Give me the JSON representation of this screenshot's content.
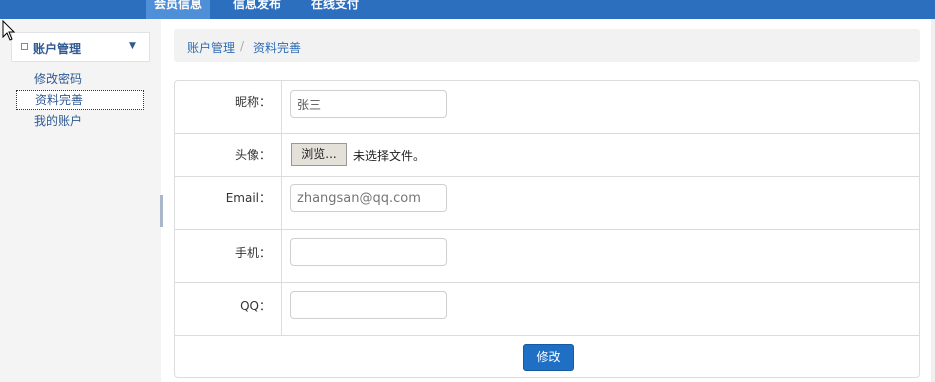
{
  "header": {
    "tabs": [
      {
        "label": "会员信息",
        "active": true
      },
      {
        "label": "信息发布",
        "active": false
      },
      {
        "label": "在线支付",
        "active": false
      }
    ]
  },
  "sidebar": {
    "section_title": "账户管理",
    "items": [
      {
        "label": "修改密码",
        "selected": false
      },
      {
        "label": "资料完善",
        "selected": true
      },
      {
        "label": "我的账户",
        "selected": false
      }
    ]
  },
  "breadcrumb": {
    "items": [
      "账户管理",
      "资料完善"
    ],
    "separator": "/"
  },
  "form": {
    "nickname": {
      "label": "昵称：",
      "value": "张三"
    },
    "avatar": {
      "label": "头像：",
      "browse_label": "浏览...",
      "file_status": "未选择文件。"
    },
    "email": {
      "label": "Email：",
      "placeholder": "zhangsan@qq.com"
    },
    "phone": {
      "label": "手机：",
      "value": ""
    },
    "qq": {
      "label": "QQ：",
      "value": ""
    },
    "submit_label": "修改"
  },
  "colors": {
    "header_bg": "#2d6fbf",
    "link": "#2f5a93",
    "button_primary": "#1f6fc5"
  }
}
